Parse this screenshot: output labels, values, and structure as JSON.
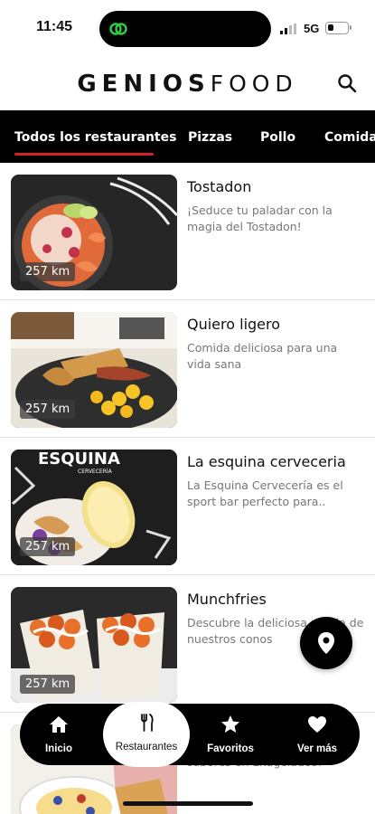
{
  "status_bar": {
    "time": "11:45",
    "network": "5G",
    "battery_level": 0.3
  },
  "header": {
    "logo_bold": "GENIOS",
    "logo_light": "FOOD"
  },
  "tabs": [
    {
      "label": "Todos los restaurantes",
      "active": true
    },
    {
      "label": "Pizzas",
      "active": false
    },
    {
      "label": "Pollo",
      "active": false
    },
    {
      "label": "Comida",
      "active": false
    }
  ],
  "restaurants": [
    {
      "name": "Tostadon",
      "description": "¡Seduce tu paladar con la magia del Tostadon!",
      "distance": "257 km",
      "image": "seafood-plate"
    },
    {
      "name": "Quiero ligero",
      "description": "Comida deliciosa para una vida sana",
      "distance": "257 km",
      "image": "breakfast-plate"
    },
    {
      "name": "La esquina cerveceria",
      "description": "La Esquina Cervecería es el sport bar perfecto para..",
      "distance": "257 km",
      "image": "cerveceria-logo-dish",
      "image_text": "ESQUINA",
      "image_subtext": "CERVECERÍA"
    },
    {
      "name": "Munchfries",
      "description": "Descubre la deliciosa magia de nuestros conos",
      "distance": "257 km",
      "image": "fries-cones"
    },
    {
      "name": "",
      "description": "sabores en Exagelados!",
      "distance": "",
      "image": "toast-plate"
    }
  ],
  "bottom_nav": [
    {
      "label": "Inicio",
      "icon": "home-icon",
      "active": false
    },
    {
      "label": "Restaurantes",
      "icon": "utensils-icon",
      "active": true
    },
    {
      "label": "Favoritos",
      "icon": "star-icon",
      "active": false
    },
    {
      "label": "Ver más",
      "icon": "heart-icon",
      "active": false
    }
  ],
  "fab": {
    "icon": "map-pin-icon"
  },
  "colors": {
    "accent": "#d32222",
    "bar": "#000000",
    "text_muted": "#777777"
  }
}
